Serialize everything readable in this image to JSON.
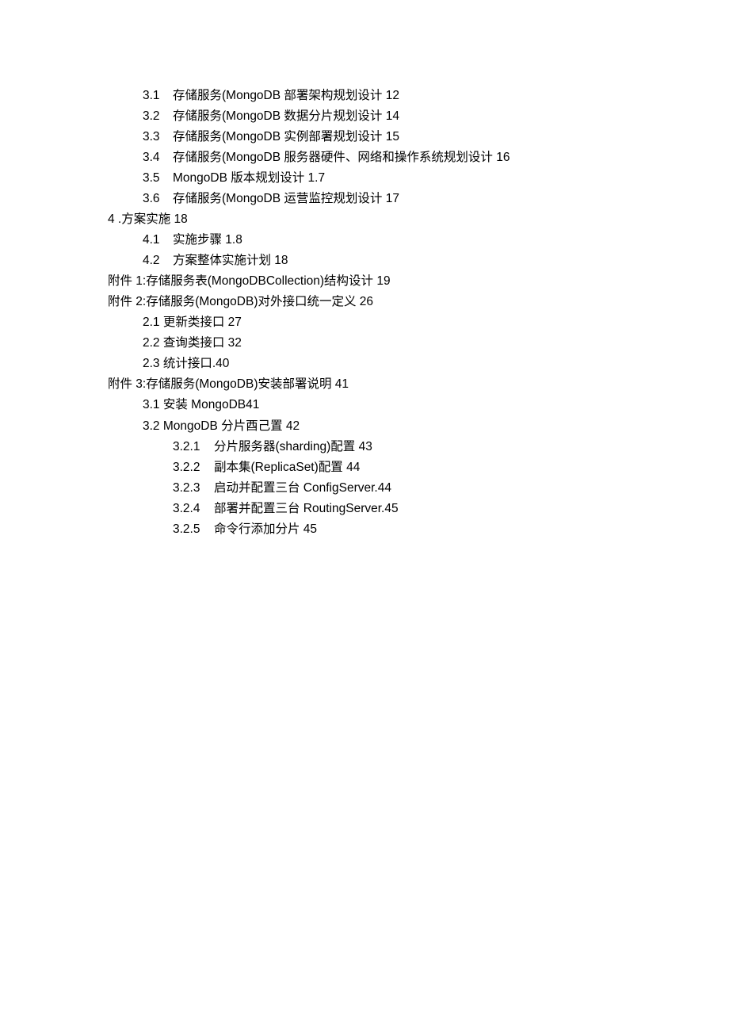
{
  "toc": {
    "lines": [
      {
        "level": 2,
        "num": "3.1",
        "numClass": "num-spaced",
        "text": "存储服务(MongoDB 部署架构规划设计 12"
      },
      {
        "level": 2,
        "num": "3.2",
        "numClass": "num-spaced",
        "text": "存储服务(MongoDB 数据分片规划设计 14"
      },
      {
        "level": 2,
        "num": "3.3",
        "numClass": "num-spaced",
        "text": "存储服务(MongoDB 实例部署规划设计 15"
      },
      {
        "level": 2,
        "num": "3.4",
        "numClass": "num-spaced",
        "text": "存储服务(MongoDB 服务器硬件、网络和操作系统规划设计 16"
      },
      {
        "level": 2,
        "num": "3.5",
        "numClass": "num-spaced",
        "text": "MongoDB 版本规划设计 1.7"
      },
      {
        "level": 2,
        "num": "3.6",
        "numClass": "num-spaced",
        "text": "存储服务(MongoDB 运营监控规划设计 17"
      },
      {
        "level": 1,
        "num": "4",
        "numClass": "num",
        "text": " .方案实施 18"
      },
      {
        "level": 2,
        "num": "4.1",
        "numClass": "num-spaced",
        "text": "实施步骤 1.8"
      },
      {
        "level": 2,
        "num": "4.2",
        "numClass": "num-spaced",
        "text": "方案整体实施计划 18"
      },
      {
        "level": 1,
        "num": "",
        "numClass": "num",
        "text": "附件 1:存储服务表(MongoDBCollection)结构设计 19"
      },
      {
        "level": 1,
        "num": "",
        "numClass": "num",
        "text": "附件 2:存储服务(MongoDB)对外接口统一定义 26"
      },
      {
        "level": "2b",
        "num": "2.1",
        "numClass": "num",
        "text": " 更新类接口 27"
      },
      {
        "level": "2b",
        "num": "2.2",
        "numClass": "num",
        "text": " 查询类接口 32"
      },
      {
        "level": "2b",
        "num": "2.3",
        "numClass": "num",
        "text": " 统计接口.40"
      },
      {
        "level": 1,
        "num": "",
        "numClass": "num",
        "text": "附件 3:存储服务(MongoDB)安装部署说明 41"
      },
      {
        "level": "2b",
        "num": "3.1",
        "numClass": "num",
        "text": " 安装 MongoDB41"
      },
      {
        "level": "2b",
        "num": "3.2",
        "numClass": "num",
        "text": " MongoDB 分片酉己置 42"
      },
      {
        "level": 3,
        "num": "3.2.1",
        "numClass": "num-spaced-3",
        "text": "分片服务器(sharding)配置 43"
      },
      {
        "level": 3,
        "num": "3.2.2",
        "numClass": "num-spaced-3",
        "text": "副本集(ReplicaSet)配置 44"
      },
      {
        "level": 3,
        "num": "3.2.3",
        "numClass": "num-spaced-3",
        "text": "启动并配置三台 ConfigServer.44"
      },
      {
        "level": 3,
        "num": "3.2.4",
        "numClass": "num-spaced-3",
        "text": "部署并配置三台 RoutingServer.45"
      },
      {
        "level": 3,
        "num": "3.2.5",
        "numClass": "num-spaced-3",
        "text": "命令行添加分片 45"
      }
    ]
  }
}
